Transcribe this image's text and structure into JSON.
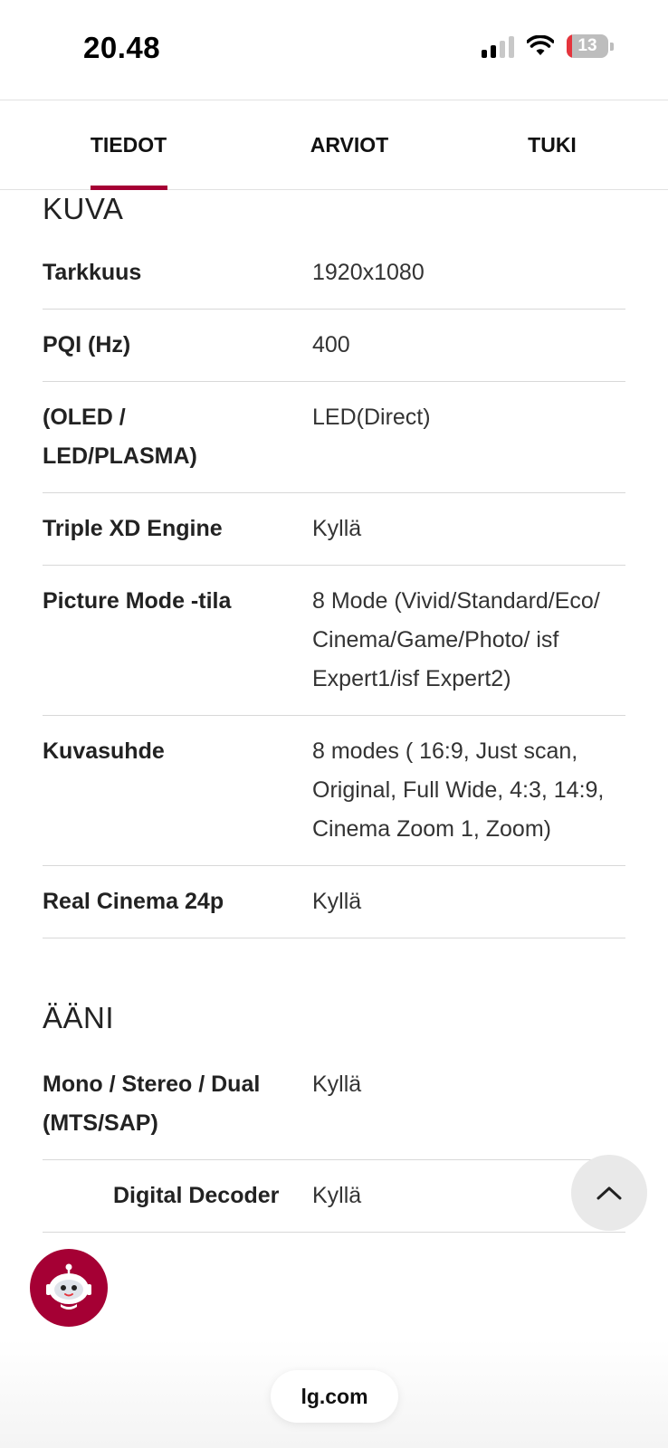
{
  "status_bar": {
    "time": "20.48",
    "battery_level": "13",
    "battery_fraction": 0.13,
    "signal_bars_active": 2,
    "signal_bars_total": 4
  },
  "tabs": [
    {
      "label": "TIEDOT",
      "active": true
    },
    {
      "label": "ARVIOT",
      "active": false
    },
    {
      "label": "TUKI",
      "active": false
    }
  ],
  "accent_color": "#a50034",
  "sections": {
    "kuva": {
      "title": "KUVA",
      "rows": [
        {
          "label": "Tarkkuus",
          "value": "1920x1080"
        },
        {
          "label": "PQI (Hz)",
          "value": "400"
        },
        {
          "label": "(OLED / LED/PLASMA)",
          "value": "LED(Direct)"
        },
        {
          "label": "Triple XD Engine",
          "value": "Kyllä"
        },
        {
          "label": "Picture Mode -tila",
          "value": "8 Mode (Vivid/Standard/Eco/ Cinema/Game/Photo/ isf Expert1/isf Expert2)"
        },
        {
          "label": "Kuvasuhde",
          "value": "8 modes ( 16:9, Just scan, Original, Full Wide, 4:3, 14:9, Cinema Zoom 1, Zoom)"
        },
        {
          "label": "Real Cinema 24p",
          "value": "Kyllä"
        }
      ]
    },
    "aani": {
      "title": "ÄÄNI",
      "rows": [
        {
          "label": "Mono / Stereo / Dual (MTS/SAP)",
          "value": "Kyllä"
        },
        {
          "label": "Digital Decoder",
          "value": "Kyllä"
        }
      ]
    }
  },
  "floating": {
    "scroll_top_icon": "chevron-up-icon",
    "chatbot_icon": "robot-icon",
    "url": "lg.com"
  }
}
